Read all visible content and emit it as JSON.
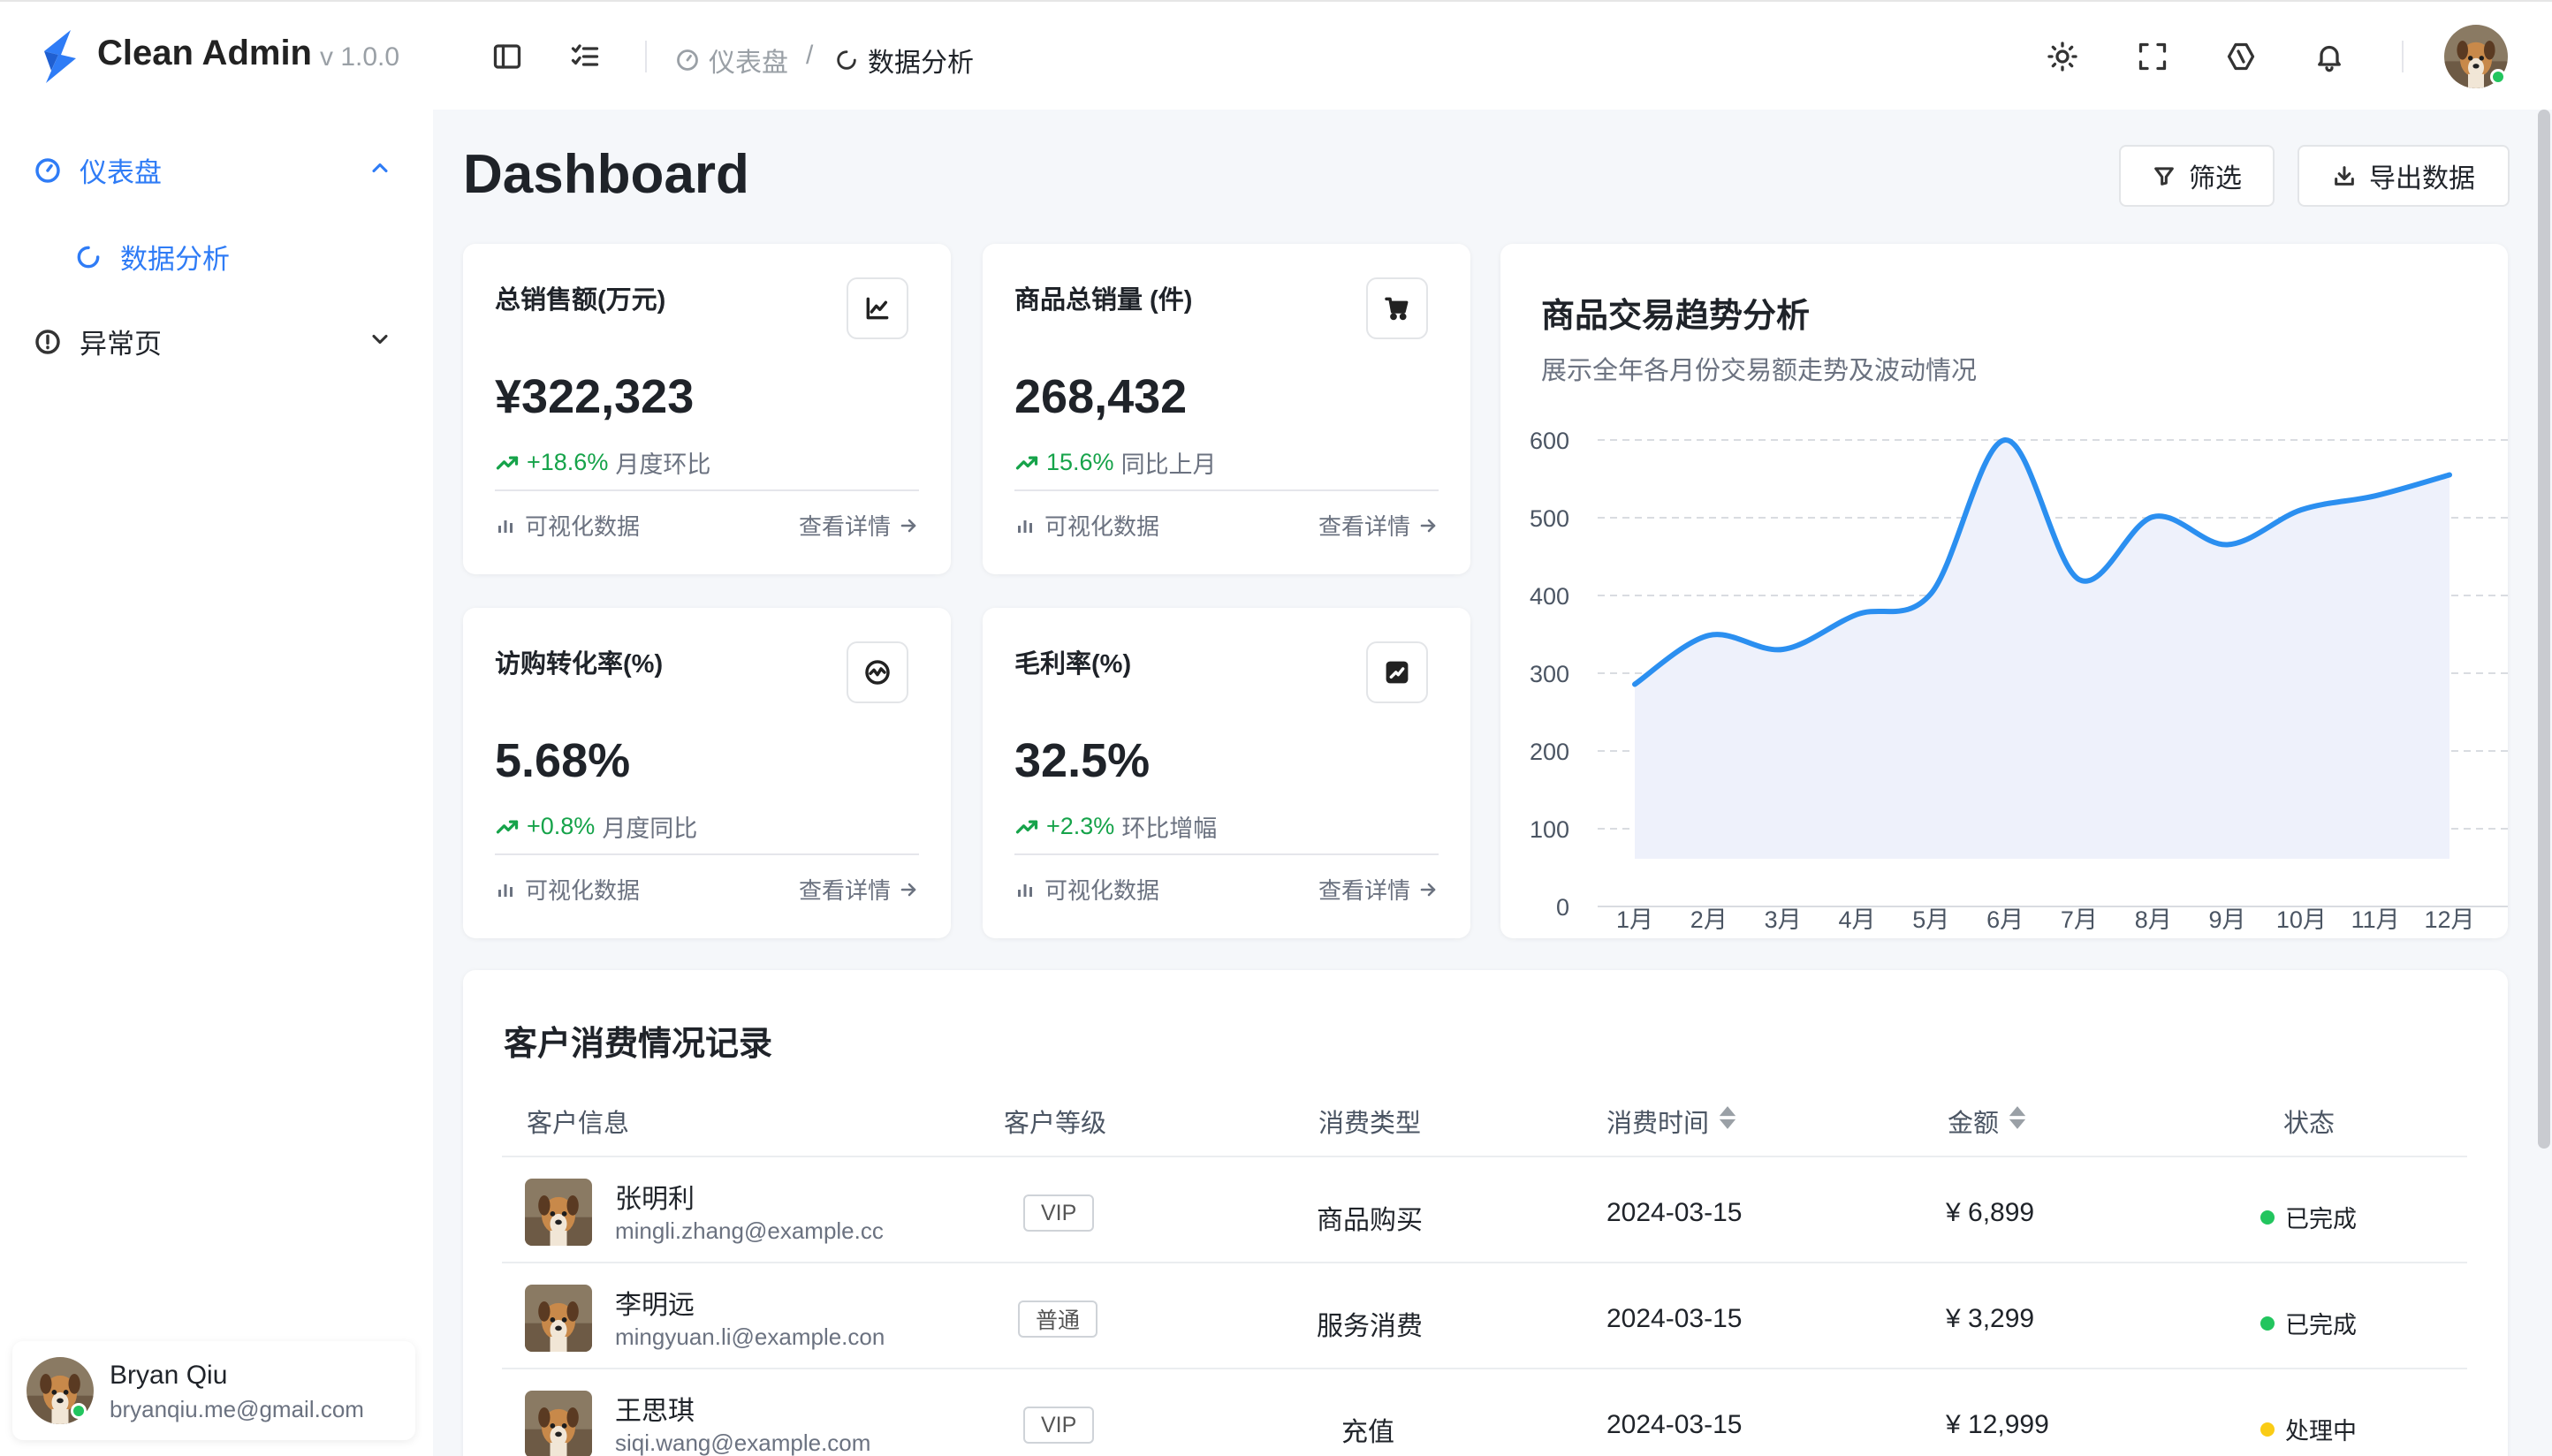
{
  "app": {
    "name": "Clean Admin",
    "version": "v 1.0.0",
    "accent": "#2f7cf6"
  },
  "header": {
    "breadcrumbs": [
      {
        "label": "仪表盘",
        "icon": "gauge-icon"
      },
      {
        "label": "数据分析",
        "icon": "loading-circle-icon"
      }
    ],
    "separator": "/",
    "icons": [
      "sidebar-toggle-icon",
      "checklist-icon",
      "sun-icon",
      "fullscreen-icon",
      "settings-hex-icon",
      "bell-icon"
    ]
  },
  "sidebar": {
    "items": [
      {
        "label": "仪表盘",
        "icon": "gauge-icon",
        "expanded": true,
        "active": true
      },
      {
        "label": "数据分析",
        "icon": "loading-circle-icon",
        "active": true
      },
      {
        "label": "异常页",
        "icon": "alert-circle-icon",
        "expanded": false
      }
    ],
    "user": {
      "name": "Bryan Qiu",
      "email": "bryanqiu.me@gmail.com"
    }
  },
  "page": {
    "title": "Dashboard",
    "filter_label": "筛选",
    "export_label": "导出数据"
  },
  "stats": [
    {
      "label": "总销售额(万元)",
      "icon": "line-chart-icon",
      "value": "¥322,323",
      "change": "+18.6%",
      "note": "月度环比",
      "foot_left": "可视化数据",
      "foot_right": "查看详情"
    },
    {
      "label": "商品总销量 (件)",
      "icon": "cart-icon",
      "value": "268,432",
      "change": "15.6%",
      "note": "同比上月",
      "foot_left": "可视化数据",
      "foot_right": "查看详情"
    },
    {
      "label": "访购转化率(%)",
      "icon": "activity-circle-icon",
      "value": "5.68%",
      "change": "+0.8%",
      "note": "月度同比",
      "foot_left": "可视化数据",
      "foot_right": "查看详情"
    },
    {
      "label": "毛利率(%)",
      "icon": "trend-box-icon",
      "value": "32.5%",
      "change": "+2.3%",
      "note": "环比增幅",
      "foot_left": "可视化数据",
      "foot_right": "查看详情"
    }
  ],
  "chart_data": {
    "type": "line",
    "title": "商品交易趋势分析",
    "subtitle": "展示全年各月份交易额走势及波动情况",
    "categories": [
      "1月",
      "2月",
      "3月",
      "4月",
      "5月",
      "6月",
      "7月",
      "8月",
      "9月",
      "10月",
      "11月",
      "12月"
    ],
    "series": [
      {
        "values": [
          250,
          320,
          300,
          350,
          380,
          600,
          400,
          490,
          450,
          500,
          520,
          550
        ]
      }
    ],
    "ylim": [
      0,
      600
    ],
    "yticks": [
      0,
      100,
      200,
      300,
      400,
      500,
      600
    ],
    "grid": true,
    "color": "#2b8ff0",
    "area_fill": "#eef1fb"
  },
  "table": {
    "title": "客户消费情况记录",
    "columns": [
      "客户信息",
      "客户等级",
      "消费类型",
      "消费时间",
      "金额",
      "状态"
    ],
    "rows": [
      {
        "name": "张明利",
        "email": "mingli.zhang@example.cc",
        "level": "VIP",
        "type": "商品购买",
        "time": "2024-03-15",
        "amount": "¥ 6,899",
        "status": "已完成",
        "status_color": "#22c55e"
      },
      {
        "name": "李明远",
        "email": "mingyuan.li@example.con",
        "level": "普通",
        "type": "服务消费",
        "time": "2024-03-15",
        "amount": "¥ 3,299",
        "status": "已完成",
        "status_color": "#22c55e"
      },
      {
        "name": "王思琪",
        "email": "siqi.wang@example.com",
        "level": "VIP",
        "type": "充值",
        "time": "2024-03-15",
        "amount": "¥ 12,999",
        "status": "处理中",
        "status_color": "#facc15"
      }
    ]
  }
}
